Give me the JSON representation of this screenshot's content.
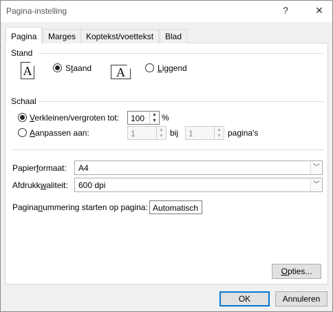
{
  "window": {
    "title": "Pagina-instelling",
    "help_label": "?",
    "close_label": "✕"
  },
  "tabs": [
    {
      "label": "Pagina",
      "active": true
    },
    {
      "label": "Marges",
      "active": false
    },
    {
      "label": "Koptekst/voettekst",
      "active": false
    },
    {
      "label": "Blad",
      "active": false
    }
  ],
  "stand": {
    "label": "Stand",
    "portrait_icon_glyph": "A",
    "landscape_icon_glyph": "A",
    "portrait": {
      "label_pre": "S",
      "label_u": "t",
      "label_post": "aand",
      "selected": true
    },
    "landscape": {
      "label_pre": "",
      "label_u": "L",
      "label_post": "iggend",
      "selected": false
    }
  },
  "schaal": {
    "label": "Schaal",
    "adjust": {
      "label_pre": "",
      "label_u": "V",
      "label_post": "erkleinen/vergroten tot:",
      "selected": true,
      "value": "100",
      "unit": "%"
    },
    "fit": {
      "label_pre": "",
      "label_u": "A",
      "label_post": "anpassen aan:",
      "selected": false,
      "wide_value": "1",
      "by_label": "bij",
      "tall_value": "1",
      "pages_label": "pagina's"
    }
  },
  "paper": {
    "size_label_pre": "Papier",
    "size_label_u": "f",
    "size_label_post": "ormaat:",
    "size_value": "A4",
    "quality_label_pre": "Afdrukk",
    "quality_label_u": "w",
    "quality_label_post": "aliteit:",
    "quality_value": "600 dpi"
  },
  "numbering": {
    "label_pre": "Pagina",
    "label_u": "n",
    "label_post": "ummering starten op pagina:",
    "value": "Automatisch"
  },
  "buttons": {
    "options_pre": "",
    "options_u": "O",
    "options_post": "pties...",
    "ok": "OK",
    "cancel": "Annuleren"
  },
  "icons": {
    "spin_up": "▲",
    "spin_down": "▼",
    "dropdown": "﹀"
  }
}
